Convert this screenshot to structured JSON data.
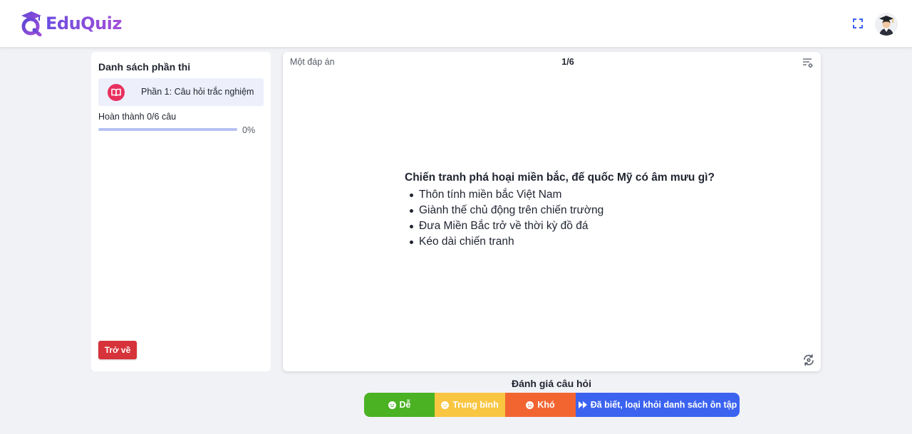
{
  "app": {
    "name": "EduQuiz"
  },
  "sidebar": {
    "title": "Danh sách phần thi",
    "sections": [
      {
        "label": "Phần 1: Câu hỏi trắc nghiệm"
      }
    ],
    "progress_label": "Hoàn thành 0/6 câu",
    "progress_value": 0,
    "progress_percent": "0%",
    "back_label": "Trở về"
  },
  "question": {
    "type_label": "Một đáp án",
    "counter": "1/6",
    "text": "Chiến tranh phá hoại miền bắc, đế quốc Mỹ có âm mưu gì?",
    "options": [
      "Thôn tính miền bắc Việt Nam",
      "Giành thế chủ động trên chiến trường",
      "Đưa Miền Bắc trở về thời kỳ đồ đá",
      "Kéo dài chiến tranh"
    ]
  },
  "rating": {
    "title": "Đánh giá câu hỏi",
    "buttons": {
      "easy": "Dễ",
      "medium": "Trung bình",
      "hard": "Khó",
      "known": "Đã biết, loại khỏi danh sách ôn tập"
    }
  },
  "colors": {
    "brand": "#7a4ee0",
    "danger": "#d6333a",
    "easy": "#4ab223",
    "medium": "#f9c642",
    "hard": "#f26531",
    "known": "#3b63f0",
    "section_icon": "#e8305f"
  },
  "icons": {
    "fullscreen": "fullscreen-icon",
    "settings": "list-settings-icon",
    "flip": "flip-card-icon",
    "section": "book-icon"
  }
}
